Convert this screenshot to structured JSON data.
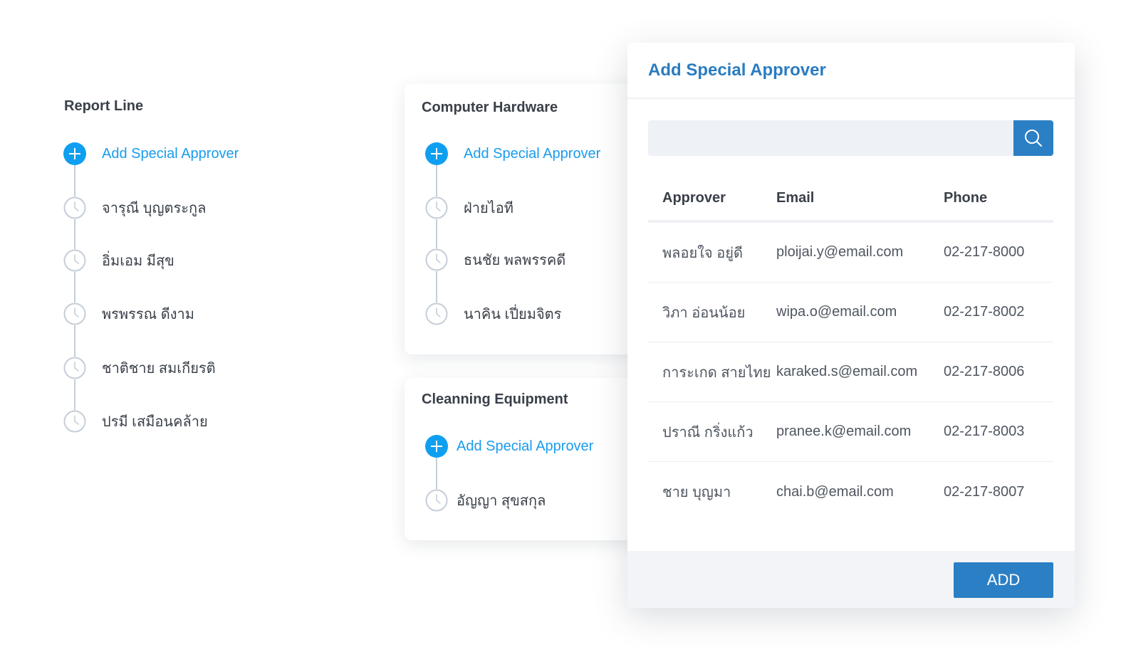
{
  "report_line": {
    "title": "Report Line",
    "add_label": "Add Special Approver",
    "people": [
      "จารุณี บุญตระกูล",
      "อิ่มเอม มีสุข",
      "พรพรรณ ดีงาม",
      "ชาติชาย สมเกียรติ",
      "ปรมี เสมือนคล้าย"
    ]
  },
  "computer_hardware": {
    "title": "Computer Hardware",
    "add_label": "Add Special Approver",
    "people": [
      "ฝ่ายไอที",
      "ธนชัย พลพรรคดี",
      "นาคิน เปี่ยมจิตร"
    ]
  },
  "cleaning_equipment": {
    "title": "Cleanning Equipment",
    "add_label": "Add Special Approver",
    "people": [
      "อัญญา สุขสกุล"
    ]
  },
  "modal": {
    "title": "Add Special Approver",
    "search": {
      "value": "",
      "icon": "search-icon"
    },
    "columns": [
      "Approver",
      "Email",
      "Phone"
    ],
    "rows": [
      {
        "approver": "พลอยใจ อยู่ดี",
        "email": "ploijai.y@email.com",
        "phone": "02-217-8000"
      },
      {
        "approver": "วิภา อ่อนน้อย",
        "email": "wipa.o@email.com",
        "phone": "02-217-8002"
      },
      {
        "approver": "การะเกด สายไทย",
        "email": "karaked.s@email.com",
        "phone": "02-217-8006"
      },
      {
        "approver": "ปราณี กริ่งแก้ว",
        "email": "pranee.k@email.com",
        "phone": "02-217-8003"
      },
      {
        "approver": "ชาย บุญมา",
        "email": "chai.b@email.com",
        "phone": "02-217-8007"
      }
    ],
    "add_button": "ADD"
  },
  "colors": {
    "accent_blue": "#0f9ff0",
    "primary_button": "#2b7fc4",
    "title_blue": "#2a7cc0",
    "timeline_line": "#c5ced8"
  }
}
